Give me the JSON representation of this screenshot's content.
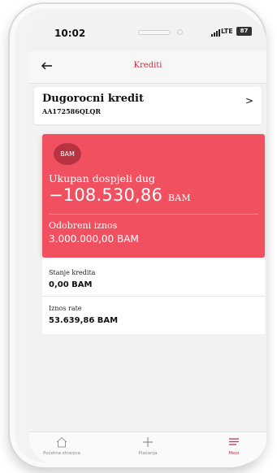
{
  "status_bar": {
    "time": "10:02",
    "network": "LTE",
    "battery": "87"
  },
  "nav": {
    "title": "Krediti"
  },
  "loan": {
    "name": "Dugorocni kredit",
    "code": "AA172586QLQR"
  },
  "card": {
    "currency_badge": "BAM",
    "due_label": "Ukupan dospjeli dug",
    "due_amount": "−108.530,86",
    "due_currency": "BAM",
    "approved_label": "Odobreni iznos",
    "approved_amount": "3.000.000,00 BAM",
    "color": "#f05060"
  },
  "details": [
    {
      "label": "Stanje kredita",
      "value": "0,00 BAM"
    },
    {
      "label": "Iznos rate",
      "value": "53.639,86 BAM"
    }
  ],
  "tab_bar": {
    "tabs": [
      {
        "label": "Početna stranica",
        "icon": "home-icon",
        "active": false
      },
      {
        "label": "Plaćanja",
        "icon": "plus-icon",
        "active": false
      },
      {
        "label": "Meni",
        "icon": "menu-icon",
        "active": true
      }
    ]
  },
  "colors": {
    "accent": "#cc2f3b",
    "card": "#f05060",
    "badge": "#b83341"
  }
}
